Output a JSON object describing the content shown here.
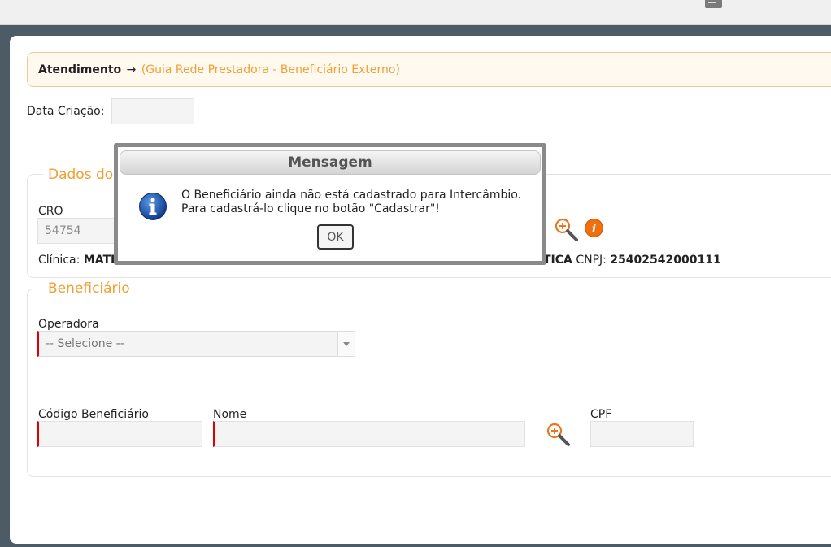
{
  "breadcrumb": {
    "section": "Atendimento",
    "arrow": "→",
    "page": "(Guia Rede Prestadora - Beneficiário Externo)"
  },
  "form": {
    "data_criacao_label": "Data Criação:",
    "data_criacao_value": ""
  },
  "dados": {
    "legend": "Dados do",
    "cro_label": "CRO",
    "cro_value": "54754",
    "clinica_label": "Clínica:",
    "clinica_value": "MATL",
    "clinica_suffix": "TICA",
    "cnpj_label": "CNPJ:",
    "cnpj_value": "25402542000111"
  },
  "beneficiario": {
    "legend": "Beneficiário",
    "operadora_label": "Operadora",
    "operadora_selected": "-- Selecione --",
    "codigo_label": "Código Beneficiário",
    "codigo_value": "",
    "nome_label": "Nome",
    "nome_value": "",
    "cpf_label": "CPF",
    "cpf_value": ""
  },
  "modal": {
    "title": "Mensagem",
    "message_line1": "O Beneficiário ainda não está cadastrado para Intercâmbio.",
    "message_line2": "Para cadastrá-lo clique no botão \"Cadastrar\"!",
    "ok_label": "OK"
  },
  "icons": {
    "search": "magnifier-plus-icon",
    "info": "info-icon",
    "modal_info": "info-circle-icon"
  },
  "colors": {
    "accent": "#f0a030",
    "required": "#e00000",
    "info_orange": "#f07010",
    "info_blue": "#1a4fa0"
  }
}
